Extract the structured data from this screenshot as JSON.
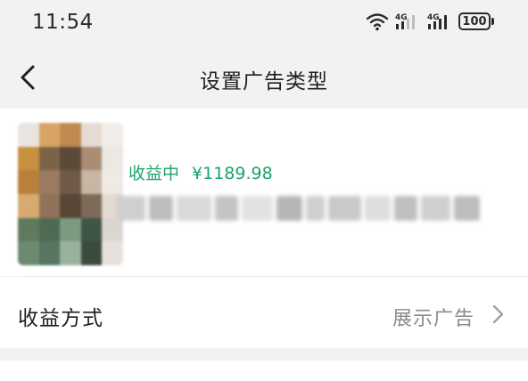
{
  "status_bar": {
    "time": "11:54",
    "network_1": "4G",
    "network_2": "4G",
    "battery": "100",
    "icons": [
      "wifi-icon",
      "signal-icon",
      "signal-icon",
      "battery-icon"
    ]
  },
  "nav": {
    "back_icon": "chevron-left-icon",
    "title": "设置广告类型"
  },
  "profile": {
    "status": "收益中",
    "amount": "¥1189.98"
  },
  "settings": {
    "label": "收益方式",
    "value": "展示广告",
    "chevron_icon": "chevron-right-icon"
  },
  "colors": {
    "accent_green": "#1ba36a",
    "background": "#f2f2f2",
    "card": "#ffffff",
    "secondary_text": "#8a8a8a"
  }
}
